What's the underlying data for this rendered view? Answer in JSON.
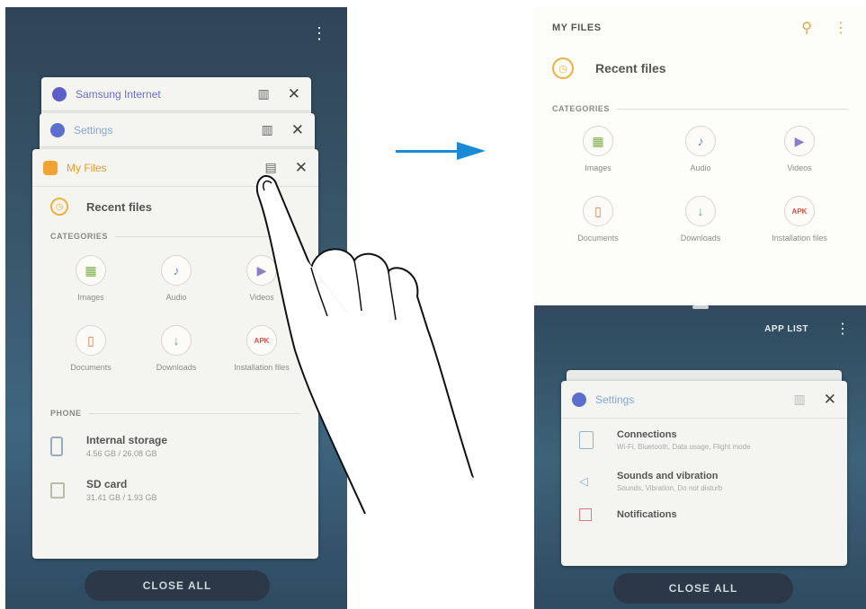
{
  "left": {
    "close_all": "CLOSE ALL",
    "cards": {
      "samsung_internet": {
        "title": "Samsung Internet",
        "icon_color": "#5c5fc8"
      },
      "settings": {
        "title": "Settings",
        "icon_color": "#5c6fcc"
      },
      "my_files": {
        "title": "My Files",
        "icon_color": "#f0a232"
      }
    },
    "recent_files": "Recent files",
    "categories_label": "CATEGORIES",
    "categories": [
      "Images",
      "Audio",
      "Videos",
      "Documents",
      "Downloads",
      "Installation files"
    ],
    "phone_label": "PHONE",
    "storage": [
      {
        "name": "Internal storage",
        "detail": "4.56 GB / 26.08 GB"
      },
      {
        "name": "SD card",
        "detail": "31.41 GB / 1.93 GB"
      }
    ],
    "apk_badge": "APK"
  },
  "right": {
    "header_title": "MY FILES",
    "recent_files": "Recent files",
    "categories_label": "CATEGORIES",
    "categories": [
      "Images",
      "Audio",
      "Videos",
      "Documents",
      "Downloads",
      "Installation files"
    ],
    "apk_badge": "APK",
    "app_list": "APP LIST",
    "settings_card": {
      "title": "Settings",
      "items": [
        {
          "name": "Connections",
          "sub": "Wi-Fi, Bluetooth, Data usage, Flight mode"
        },
        {
          "name": "Sounds and vibration",
          "sub": "Sounds, Vibration, Do not disturb"
        },
        {
          "name": "Notifications",
          "sub": ""
        }
      ]
    },
    "close_all": "CLOSE ALL"
  },
  "colors": {
    "accent_arrow": "#1b8ad6",
    "my_files_title": "#e89a2a"
  }
}
